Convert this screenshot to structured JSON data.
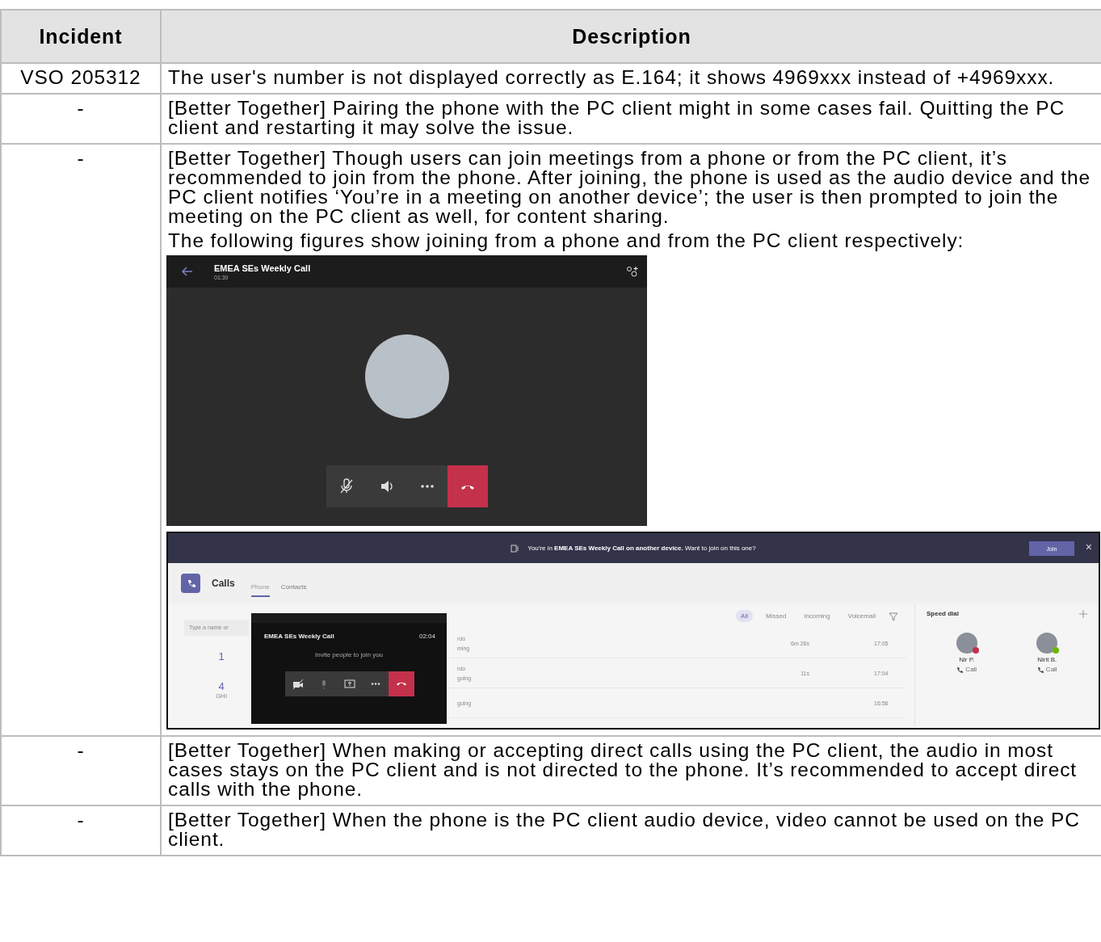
{
  "table": {
    "columns": [
      "Incident",
      "Description"
    ],
    "rows": [
      {
        "incident": "VSO 205312",
        "paragraphs": [
          "The user's number is not displayed correctly as E.164; it shows 4969xxx instead of +4969xxx."
        ]
      },
      {
        "incident": "-",
        "paragraphs": [
          "[Better Together] Pairing the phone with the PC client might in some cases fail. Quitting the PC client and restarting it may solve the issue."
        ]
      },
      {
        "incident": "-",
        "paragraphs": [
          "[Better Together] Though users can join meetings from a phone or from the PC client, it’s recommended to join from the phone. After joining, the phone is used as the audio device and the PC client notifies ‘You’re in a meeting on another device’; the user is then prompted to join the meeting on the PC client as well, for content sharing.",
          "The following figures show joining from a phone and from the PC client respectively:"
        ],
        "figures": [
          {
            "kind": "phone_call",
            "title": "EMEA SEs Weekly Call",
            "timer": "01:30"
          },
          {
            "kind": "pc_client",
            "banner": "You're in **EMEA SEs Weekly Call on another device.** Want to join on this one?",
            "join_button": "Join",
            "close": "×",
            "app_title": "Calls",
            "tabs": [
              {
                "label": "Phone",
                "selected": true
              },
              {
                "label": "Contacts",
                "selected": false
              }
            ],
            "search_placeholder": "Type a name or",
            "dial_keys": [
              {
                "digit": "1"
              },
              {
                "digit": "4",
                "letters": "GHI"
              }
            ],
            "popup": {
              "title": "EMEA SEs Weekly Call",
              "timer": "02:04",
              "message": "Invite people to join you"
            },
            "filters": [
              {
                "label": "All",
                "selected": true
              },
              {
                "label": "Missed",
                "selected": false
              },
              {
                "label": "Incoming",
                "selected": false
              },
              {
                "label": "Voicemail",
                "selected": false
              }
            ],
            "history": [
              {
                "name": "rdo",
                "detail": "ming",
                "duration": "6m 26s",
                "time": "17:05"
              },
              {
                "name": "rdo",
                "detail": "going",
                "duration": "11s",
                "time": "17:04"
              },
              {
                "detail": "going",
                "time": "16:56"
              }
            ],
            "speed_dial": {
              "title": "Speed dial",
              "contacts": [
                {
                  "name": "Nir P.",
                  "action": "Call",
                  "color": "#c4314b"
                },
                {
                  "name": "Nirit B.",
                  "action": "Call",
                  "color": "#6bb700"
                }
              ]
            }
          }
        ]
      },
      {
        "incident": "-",
        "paragraphs": [
          "[Better Together] When making or accepting direct calls using the PC client, the audio in most cases stays on the PC client and is not directed to the phone. It’s recommended to accept direct calls with the phone."
        ]
      },
      {
        "incident": "-",
        "paragraphs": [
          "[Better Together] When the phone is the PC client audio device, video cannot be used on the PC client."
        ]
      }
    ]
  }
}
